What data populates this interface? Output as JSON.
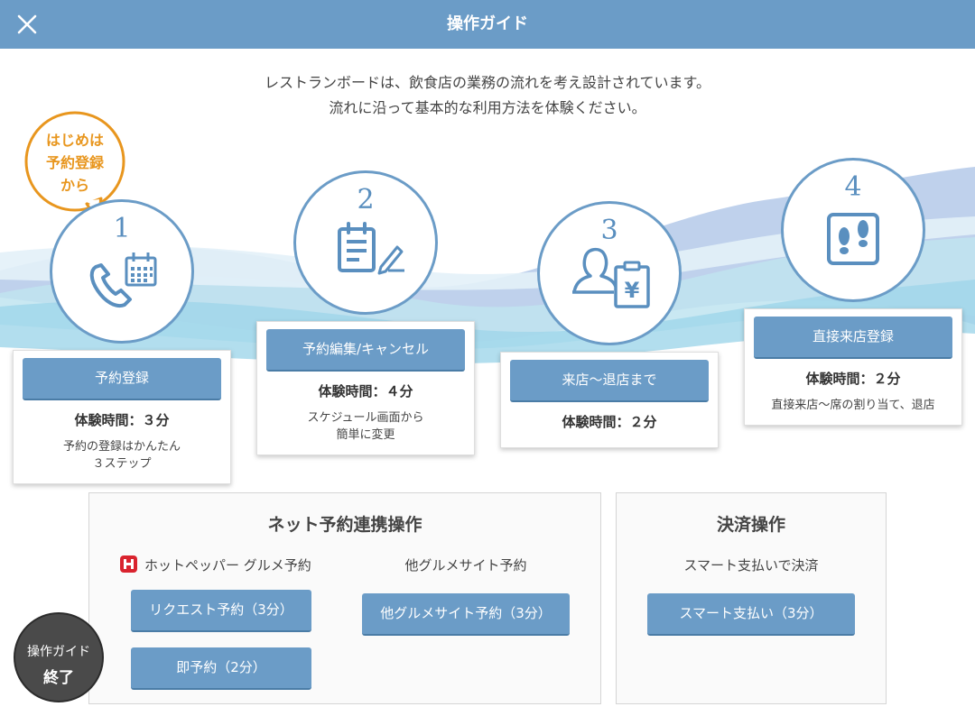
{
  "header": {
    "title": "操作ガイド"
  },
  "intro": {
    "line1": "レストランボードは、飲食店の業務の流れを考え設計されています。",
    "line2": "流れに沿って基本的な利用方法を体験ください。"
  },
  "bubble": {
    "line1": "はじめは",
    "line2": "予約登録",
    "line3": "から"
  },
  "steps": [
    {
      "number": "1",
      "icon": "phone-calendar-icon",
      "button": "予約登録",
      "time": "体験時間：３分",
      "desc1": "予約の登録はかんたん",
      "desc2": "３ステップ"
    },
    {
      "number": "2",
      "icon": "clipboard-pen-icon",
      "button": "予約編集/キャンセル",
      "time": "体験時間：４分",
      "desc1": "スケジュール画面から",
      "desc2": "簡単に変更"
    },
    {
      "number": "3",
      "icon": "customer-receipt-icon",
      "button": "来店〜退店まで",
      "time": "体験時間：２分"
    },
    {
      "number": "4",
      "icon": "footprints-icon",
      "button": "直接来店登録",
      "time": "体験時間：２分",
      "desc1": "直接来店〜席の割り当て、退店"
    }
  ],
  "net_panel": {
    "title": "ネット予約連携操作",
    "hotpepper_label": "ホットペッパー グルメ予約",
    "request_button": "リクエスト予約（3分）",
    "instant_button": "即予約（2分）",
    "other_label": "他グルメサイト予約",
    "other_button": "他グルメサイト予約（3分）"
  },
  "payment_panel": {
    "title": "決済操作",
    "label": "スマート支払いで決済",
    "button": "スマート支払い（3分）"
  },
  "end_button": {
    "line1": "操作ガイド",
    "line2": "終了"
  },
  "colors": {
    "header": "#6b9cc7",
    "accent_orange": "#e8961e",
    "button": "#6b9cc7",
    "end_button": "#4a4a4a"
  }
}
